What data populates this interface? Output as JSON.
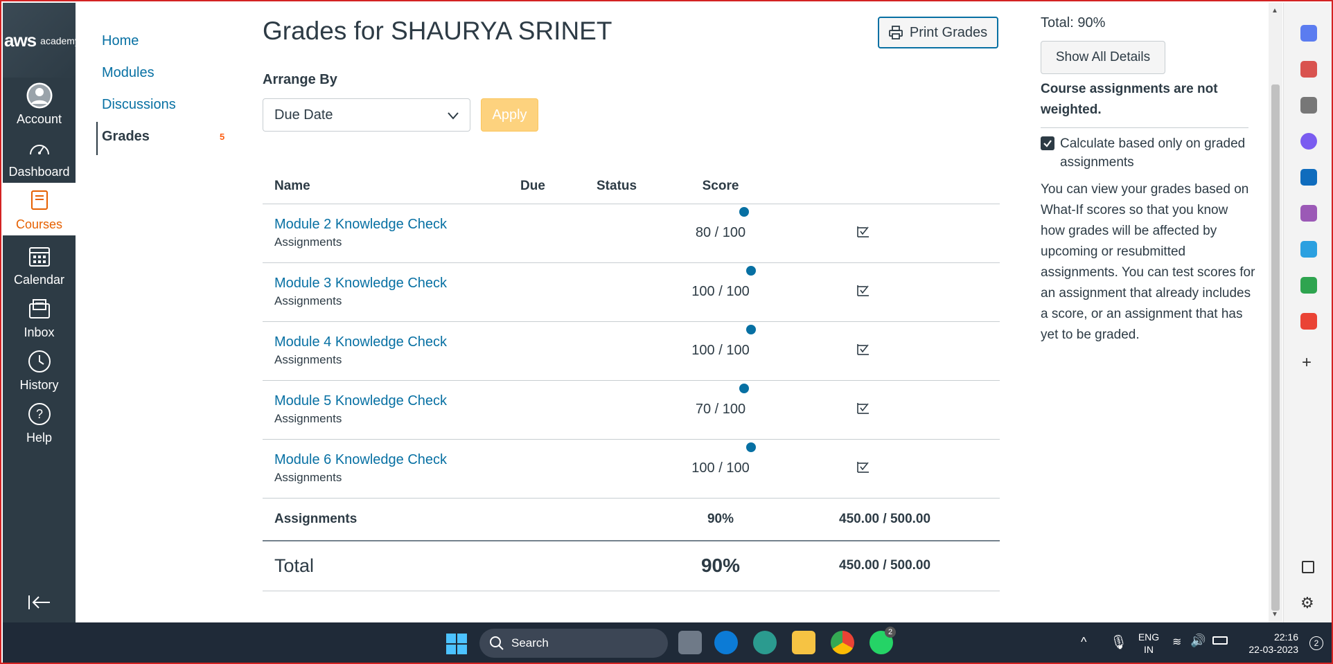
{
  "global_nav": {
    "logo_text": "aws",
    "logo_sub": "academy",
    "items": [
      {
        "label": "Account",
        "icon": "user-icon"
      },
      {
        "label": "Dashboard",
        "icon": "dashboard-icon"
      },
      {
        "label": "Courses",
        "icon": "courses-icon"
      },
      {
        "label": "Calendar",
        "icon": "calendar-icon"
      },
      {
        "label": "Inbox",
        "icon": "inbox-icon"
      },
      {
        "label": "History",
        "icon": "history-icon"
      },
      {
        "label": "Help",
        "icon": "help-icon"
      }
    ],
    "active": "Courses"
  },
  "course_nav": {
    "items": [
      {
        "label": "Home"
      },
      {
        "label": "Modules"
      },
      {
        "label": "Discussions"
      },
      {
        "label": "Grades",
        "badge": "5"
      }
    ]
  },
  "main": {
    "title": "Grades for SHAURYA SRINET",
    "print_label": "Print Grades",
    "arrange_label": "Arrange By",
    "arrange_value": "Due Date",
    "apply_label": "Apply",
    "table": {
      "headers": [
        "Name",
        "Due",
        "Status",
        "Score"
      ],
      "rows": [
        {
          "name": "Module 2 Knowledge Check",
          "category": "Assignments",
          "score": "80 / 100"
        },
        {
          "name": "Module 3 Knowledge Check",
          "category": "Assignments",
          "score": "100 / 100"
        },
        {
          "name": "Module 4 Knowledge Check",
          "category": "Assignments",
          "score": "100 / 100"
        },
        {
          "name": "Module 5 Knowledge Check",
          "category": "Assignments",
          "score": "70 / 100"
        },
        {
          "name": "Module 6 Knowledge Check",
          "category": "Assignments",
          "score": "100 / 100"
        }
      ],
      "summary": {
        "label": "Assignments",
        "percent": "90%",
        "points": "450.00 / 500.00"
      },
      "total": {
        "label": "Total",
        "percent": "90%",
        "points": "450.00 / 500.00"
      }
    }
  },
  "sidebar": {
    "total": "Total: 90%",
    "show_all_label": "Show All Details",
    "weighted_note": "Course assignments are not weighted.",
    "calc_label": "Calculate based only on graded assignments",
    "calc_checked": true,
    "whatif_text": "You can view your grades based on What-If scores so that you know how grades will be affected by upcoming or resubmitted assignments. You can test scores for an assignment that already includes a score, or an assignment that has yet to be graded."
  },
  "taskbar": {
    "search_placeholder": "Search",
    "lang_top": "ENG",
    "lang_bottom": "IN",
    "time": "22:16",
    "date": "22-03-2023",
    "whatsapp_badge": "2",
    "notif_count": "2"
  },
  "colors": {
    "nav_bg": "#2d3b45",
    "link": "#0770a3",
    "active_course": "#e66000",
    "apply_disabled": "#fdd27e",
    "taskbar": "#1f2a38"
  }
}
